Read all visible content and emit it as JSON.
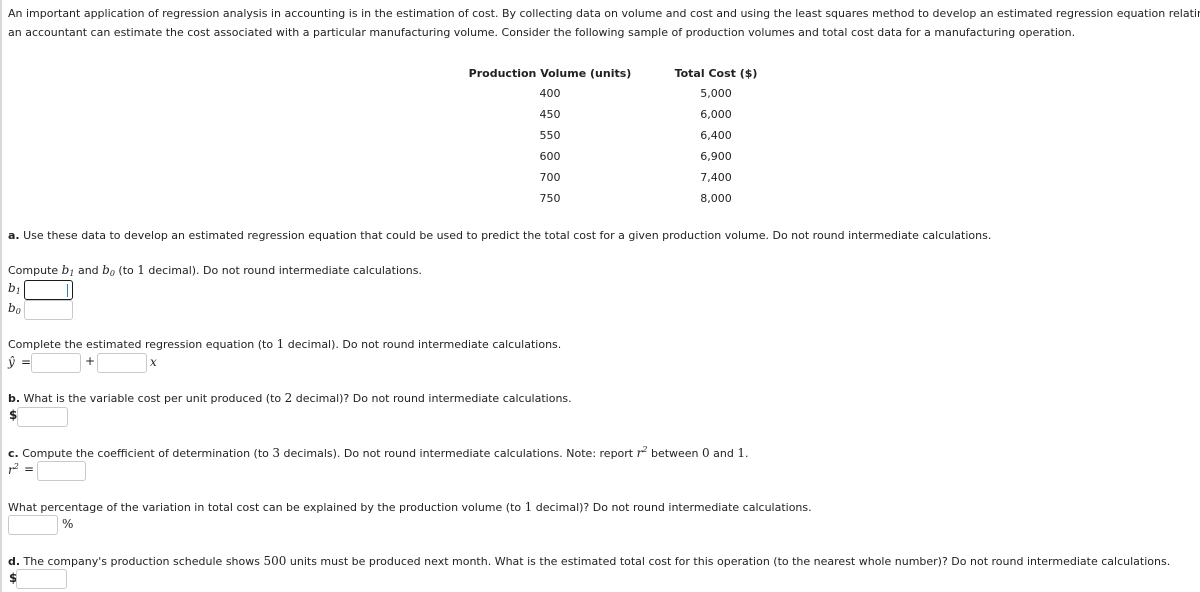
{
  "intro": {
    "line1": "An important application of regression analysis in accounting is in the estimation of cost. By collecting data on volume and cost and using the least squares method to develop an estimated regression equation relating volume and cost,",
    "line2": "an accountant can estimate the cost associated with a particular manufacturing volume. Consider the following sample of production volumes and total cost data for a manufacturing operation."
  },
  "table": {
    "headers": [
      "Production Volume (units)",
      "Total Cost ($)"
    ],
    "rows": [
      [
        "400",
        "5,000"
      ],
      [
        "450",
        "6,000"
      ],
      [
        "550",
        "6,400"
      ],
      [
        "600",
        "6,900"
      ],
      [
        "700",
        "7,400"
      ],
      [
        "750",
        "8,000"
      ]
    ]
  },
  "part_a": {
    "label": "a.",
    "question": " Use these data to develop an estimated regression equation that could be used to predict the total cost for a given production volume. Do not round intermediate calculations.",
    "compute_prefix": "Compute ",
    "b1_sym": "b",
    "b1_sub": "1",
    "and": " and ",
    "b0_sym": "b",
    "b0_sub": "0",
    "compute_suffix_1": " (to ",
    "compute_decimal": "1",
    "compute_suffix_2": " decimal). Do not round intermediate calculations.",
    "b1_value": "",
    "b0_value": "",
    "equation_prompt_1": "Complete the estimated regression equation (to ",
    "equation_decimal": "1",
    "equation_prompt_2": " decimal). Do not round intermediate calculations.",
    "yhat": "ŷ",
    "equals": "=",
    "plus": "+",
    "x": "x",
    "intercept_value": "",
    "slope_value": ""
  },
  "part_b": {
    "label": "b.",
    "question_1": " What is the variable cost per unit produced (to ",
    "decimal": "2",
    "question_2": " decimal)? Do not round intermediate calculations.",
    "currency": "$",
    "value": ""
  },
  "part_c": {
    "label": "c.",
    "question_1": " Compute the coefficient of determination (to ",
    "decimal": "3",
    "question_2": " decimals). Do not round intermediate calculations. Note: report ",
    "r_sym": "r",
    "r_sup": "2",
    "question_3": " between ",
    "zero": "0",
    "and": " and ",
    "one": "1",
    "period": ".",
    "equals": "=",
    "r2_value": "",
    "percent_prompt_1": "What percentage of the variation in total cost can be explained by the production volume (to ",
    "percent_decimal": "1",
    "percent_prompt_2": " decimal)? Do not round intermediate calculations.",
    "percent_sign": "%",
    "percent_value": ""
  },
  "part_d": {
    "label": "d.",
    "question_1": " The company's production schedule shows ",
    "units": "500",
    "question_2": " units must be produced next month. What is the estimated total cost for this operation (to the nearest whole number)? Do not round intermediate calculations.",
    "currency": "$",
    "value": ""
  }
}
